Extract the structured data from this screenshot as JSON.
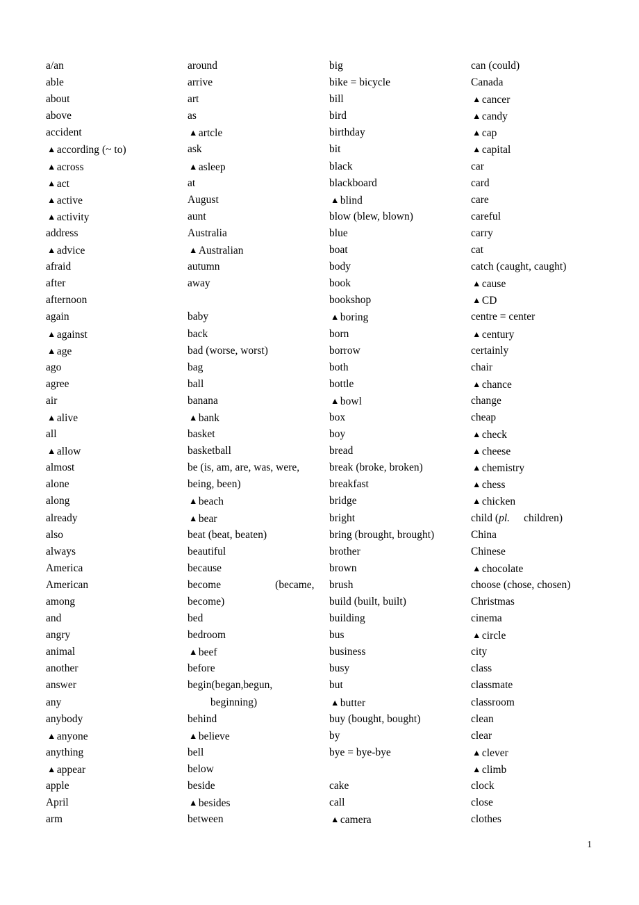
{
  "document": {
    "type": "vocabulary-word-list",
    "page_number": "1",
    "marker_glyph": "▲",
    "marker_meaning_icon": "triangle-marker-icon",
    "column_count": 4,
    "text_color": "#000000",
    "background_color": "#ffffff"
  },
  "columns": [
    {
      "id": "column-1",
      "entries": [
        {
          "marker": false,
          "text": "a/an"
        },
        {
          "marker": false,
          "text": "able"
        },
        {
          "marker": false,
          "text": "about"
        },
        {
          "marker": false,
          "text": "above"
        },
        {
          "marker": false,
          "text": "accident"
        },
        {
          "marker": true,
          "text": "according (~ to)"
        },
        {
          "marker": true,
          "text": "across"
        },
        {
          "marker": true,
          "text": "act"
        },
        {
          "marker": true,
          "text": "active"
        },
        {
          "marker": true,
          "text": "activity"
        },
        {
          "marker": false,
          "text": "address"
        },
        {
          "marker": true,
          "text": "advice"
        },
        {
          "marker": false,
          "text": "afraid"
        },
        {
          "marker": false,
          "text": "after"
        },
        {
          "marker": false,
          "text": "afternoon"
        },
        {
          "marker": false,
          "text": "again"
        },
        {
          "marker": true,
          "text": "against"
        },
        {
          "marker": true,
          "text": "age"
        },
        {
          "marker": false,
          "text": "ago"
        },
        {
          "marker": false,
          "text": "agree"
        },
        {
          "marker": false,
          "text": "air"
        },
        {
          "marker": true,
          "text": "alive"
        },
        {
          "marker": false,
          "text": "all"
        },
        {
          "marker": true,
          "text": "allow"
        },
        {
          "marker": false,
          "text": "almost"
        },
        {
          "marker": false,
          "text": "alone"
        },
        {
          "marker": false,
          "text": "along"
        },
        {
          "marker": false,
          "text": "already"
        },
        {
          "marker": false,
          "text": "also"
        },
        {
          "marker": false,
          "text": "always"
        },
        {
          "marker": false,
          "text": "America"
        },
        {
          "marker": false,
          "text": "American"
        },
        {
          "marker": false,
          "text": "among"
        },
        {
          "marker": false,
          "text": "and"
        },
        {
          "marker": false,
          "text": "angry"
        },
        {
          "marker": false,
          "text": "animal"
        },
        {
          "marker": false,
          "text": "another"
        },
        {
          "marker": false,
          "text": "answer"
        },
        {
          "marker": false,
          "text": "any"
        },
        {
          "marker": false,
          "text": "anybody"
        },
        {
          "marker": true,
          "text": "anyone"
        },
        {
          "marker": false,
          "text": "anything"
        },
        {
          "marker": true,
          "text": "appear"
        },
        {
          "marker": false,
          "text": "apple"
        },
        {
          "marker": false,
          "text": "April"
        },
        {
          "marker": false,
          "text": "arm"
        }
      ]
    },
    {
      "id": "column-2",
      "entries": [
        {
          "marker": false,
          "text": "around"
        },
        {
          "marker": false,
          "text": "arrive"
        },
        {
          "marker": false,
          "text": "art"
        },
        {
          "marker": false,
          "text": "as"
        },
        {
          "marker": true,
          "text": "artcle"
        },
        {
          "marker": false,
          "text": "ask"
        },
        {
          "marker": true,
          "text": "asleep"
        },
        {
          "marker": false,
          "text": "at"
        },
        {
          "marker": false,
          "text": "August"
        },
        {
          "marker": false,
          "text": "aunt"
        },
        {
          "marker": false,
          "text": "Australia"
        },
        {
          "marker": true,
          "text": "Australian"
        },
        {
          "marker": false,
          "text": "autumn"
        },
        {
          "marker": false,
          "text": "away"
        },
        {
          "marker": false,
          "text": "",
          "blank": true
        },
        {
          "marker": false,
          "text": "baby"
        },
        {
          "marker": false,
          "text": "back"
        },
        {
          "marker": false,
          "text": "bad (worse, worst)"
        },
        {
          "marker": false,
          "text": "bag"
        },
        {
          "marker": false,
          "text": "ball"
        },
        {
          "marker": false,
          "text": "banana"
        },
        {
          "marker": true,
          "text": "bank"
        },
        {
          "marker": false,
          "text": "basket"
        },
        {
          "marker": false,
          "text": "basketball"
        },
        {
          "marker": false,
          "text": "be (is, am, are, was, were,"
        },
        {
          "marker": false,
          "text": "being, been)"
        },
        {
          "marker": true,
          "text": "beach"
        },
        {
          "marker": true,
          "text": "bear"
        },
        {
          "marker": false,
          "text": "beat (beat, beaten)"
        },
        {
          "marker": false,
          "text": "beautiful"
        },
        {
          "marker": false,
          "text": "because"
        },
        {
          "marker": false,
          "text": "become",
          "gap": "large",
          "text2": "(became,"
        },
        {
          "marker": false,
          "text": "become)"
        },
        {
          "marker": false,
          "text": "bed"
        },
        {
          "marker": false,
          "text": "bedroom"
        },
        {
          "marker": true,
          "text": "beef"
        },
        {
          "marker": false,
          "text": "before"
        },
        {
          "marker": false,
          "text": "begin(began,begun,"
        },
        {
          "marker": false,
          "text": "beginning)",
          "indent": true
        },
        {
          "marker": false,
          "text": "behind"
        },
        {
          "marker": true,
          "text": "believe"
        },
        {
          "marker": false,
          "text": "bell"
        },
        {
          "marker": false,
          "text": "below"
        },
        {
          "marker": false,
          "text": "beside"
        },
        {
          "marker": true,
          "text": "besides"
        },
        {
          "marker": false,
          "text": "between"
        }
      ]
    },
    {
      "id": "column-3",
      "entries": [
        {
          "marker": false,
          "text": "big"
        },
        {
          "marker": false,
          "text": "bike = bicycle"
        },
        {
          "marker": false,
          "text": "bill"
        },
        {
          "marker": false,
          "text": "bird"
        },
        {
          "marker": false,
          "text": "birthday"
        },
        {
          "marker": false,
          "text": "bit"
        },
        {
          "marker": false,
          "text": "black"
        },
        {
          "marker": false,
          "text": "blackboard"
        },
        {
          "marker": true,
          "text": "blind"
        },
        {
          "marker": false,
          "text": "blow (blew, blown)"
        },
        {
          "marker": false,
          "text": "blue"
        },
        {
          "marker": false,
          "text": "boat"
        },
        {
          "marker": false,
          "text": "body"
        },
        {
          "marker": false,
          "text": "book"
        },
        {
          "marker": false,
          "text": "bookshop"
        },
        {
          "marker": true,
          "text": "boring"
        },
        {
          "marker": false,
          "text": "born"
        },
        {
          "marker": false,
          "text": "borrow"
        },
        {
          "marker": false,
          "text": "both"
        },
        {
          "marker": false,
          "text": "bottle"
        },
        {
          "marker": true,
          "text": "bowl"
        },
        {
          "marker": false,
          "text": "box"
        },
        {
          "marker": false,
          "text": "boy"
        },
        {
          "marker": false,
          "text": "bread"
        },
        {
          "marker": false,
          "text": "break (broke, broken)"
        },
        {
          "marker": false,
          "text": "breakfast"
        },
        {
          "marker": false,
          "text": "bridge"
        },
        {
          "marker": false,
          "text": "bright"
        },
        {
          "marker": false,
          "text": "bring (brought, brought)"
        },
        {
          "marker": false,
          "text": "brother"
        },
        {
          "marker": false,
          "text": "brown"
        },
        {
          "marker": false,
          "text": "brush"
        },
        {
          "marker": false,
          "text": "build (built, built)"
        },
        {
          "marker": false,
          "text": "building"
        },
        {
          "marker": false,
          "text": "bus"
        },
        {
          "marker": false,
          "text": "business"
        },
        {
          "marker": false,
          "text": "busy"
        },
        {
          "marker": false,
          "text": "but"
        },
        {
          "marker": true,
          "text": "butter"
        },
        {
          "marker": false,
          "text": "buy (bought, bought)"
        },
        {
          "marker": false,
          "text": "by"
        },
        {
          "marker": false,
          "text": "bye = bye-bye"
        },
        {
          "marker": false,
          "text": "",
          "blank": true
        },
        {
          "marker": false,
          "text": "cake"
        },
        {
          "marker": false,
          "text": "call"
        },
        {
          "marker": true,
          "text": "camera"
        }
      ]
    },
    {
      "id": "column-4",
      "entries": [
        {
          "marker": false,
          "text": "can (could)"
        },
        {
          "marker": false,
          "text": "Canada"
        },
        {
          "marker": true,
          "text": "cancer"
        },
        {
          "marker": true,
          "text": "candy"
        },
        {
          "marker": true,
          "text": "cap"
        },
        {
          "marker": true,
          "text": "capital"
        },
        {
          "marker": false,
          "text": "car"
        },
        {
          "marker": false,
          "text": "card"
        },
        {
          "marker": false,
          "text": "care"
        },
        {
          "marker": false,
          "text": "careful"
        },
        {
          "marker": false,
          "text": "carry"
        },
        {
          "marker": false,
          "text": "cat"
        },
        {
          "marker": false,
          "text": "catch (caught, caught)"
        },
        {
          "marker": true,
          "text": "cause"
        },
        {
          "marker": true,
          "text": "CD"
        },
        {
          "marker": false,
          "text": "centre = center"
        },
        {
          "marker": true,
          "text": "century"
        },
        {
          "marker": false,
          "text": "certainly"
        },
        {
          "marker": false,
          "text": "chair"
        },
        {
          "marker": true,
          "text": "chance"
        },
        {
          "marker": false,
          "text": "change"
        },
        {
          "marker": false,
          "text": "cheap"
        },
        {
          "marker": true,
          "text": "check"
        },
        {
          "marker": true,
          "text": "cheese"
        },
        {
          "marker": true,
          "text": "chemistry"
        },
        {
          "marker": true,
          "text": "chess"
        },
        {
          "marker": true,
          "text": "chicken"
        },
        {
          "marker": false,
          "text": "child (",
          "italic": "pl.",
          "gap": "small",
          "text2": "children)"
        },
        {
          "marker": false,
          "text": "China"
        },
        {
          "marker": false,
          "text": "Chinese"
        },
        {
          "marker": true,
          "text": "chocolate"
        },
        {
          "marker": false,
          "text": "choose (chose, chosen)"
        },
        {
          "marker": false,
          "text": "Christmas"
        },
        {
          "marker": false,
          "text": "cinema"
        },
        {
          "marker": true,
          "text": "circle"
        },
        {
          "marker": false,
          "text": "city"
        },
        {
          "marker": false,
          "text": "class"
        },
        {
          "marker": false,
          "text": "classmate"
        },
        {
          "marker": false,
          "text": "classroom"
        },
        {
          "marker": false,
          "text": "clean"
        },
        {
          "marker": false,
          "text": "clear"
        },
        {
          "marker": true,
          "text": "clever"
        },
        {
          "marker": true,
          "text": "climb"
        },
        {
          "marker": false,
          "text": "clock"
        },
        {
          "marker": false,
          "text": "close"
        },
        {
          "marker": false,
          "text": "clothes"
        }
      ]
    }
  ]
}
